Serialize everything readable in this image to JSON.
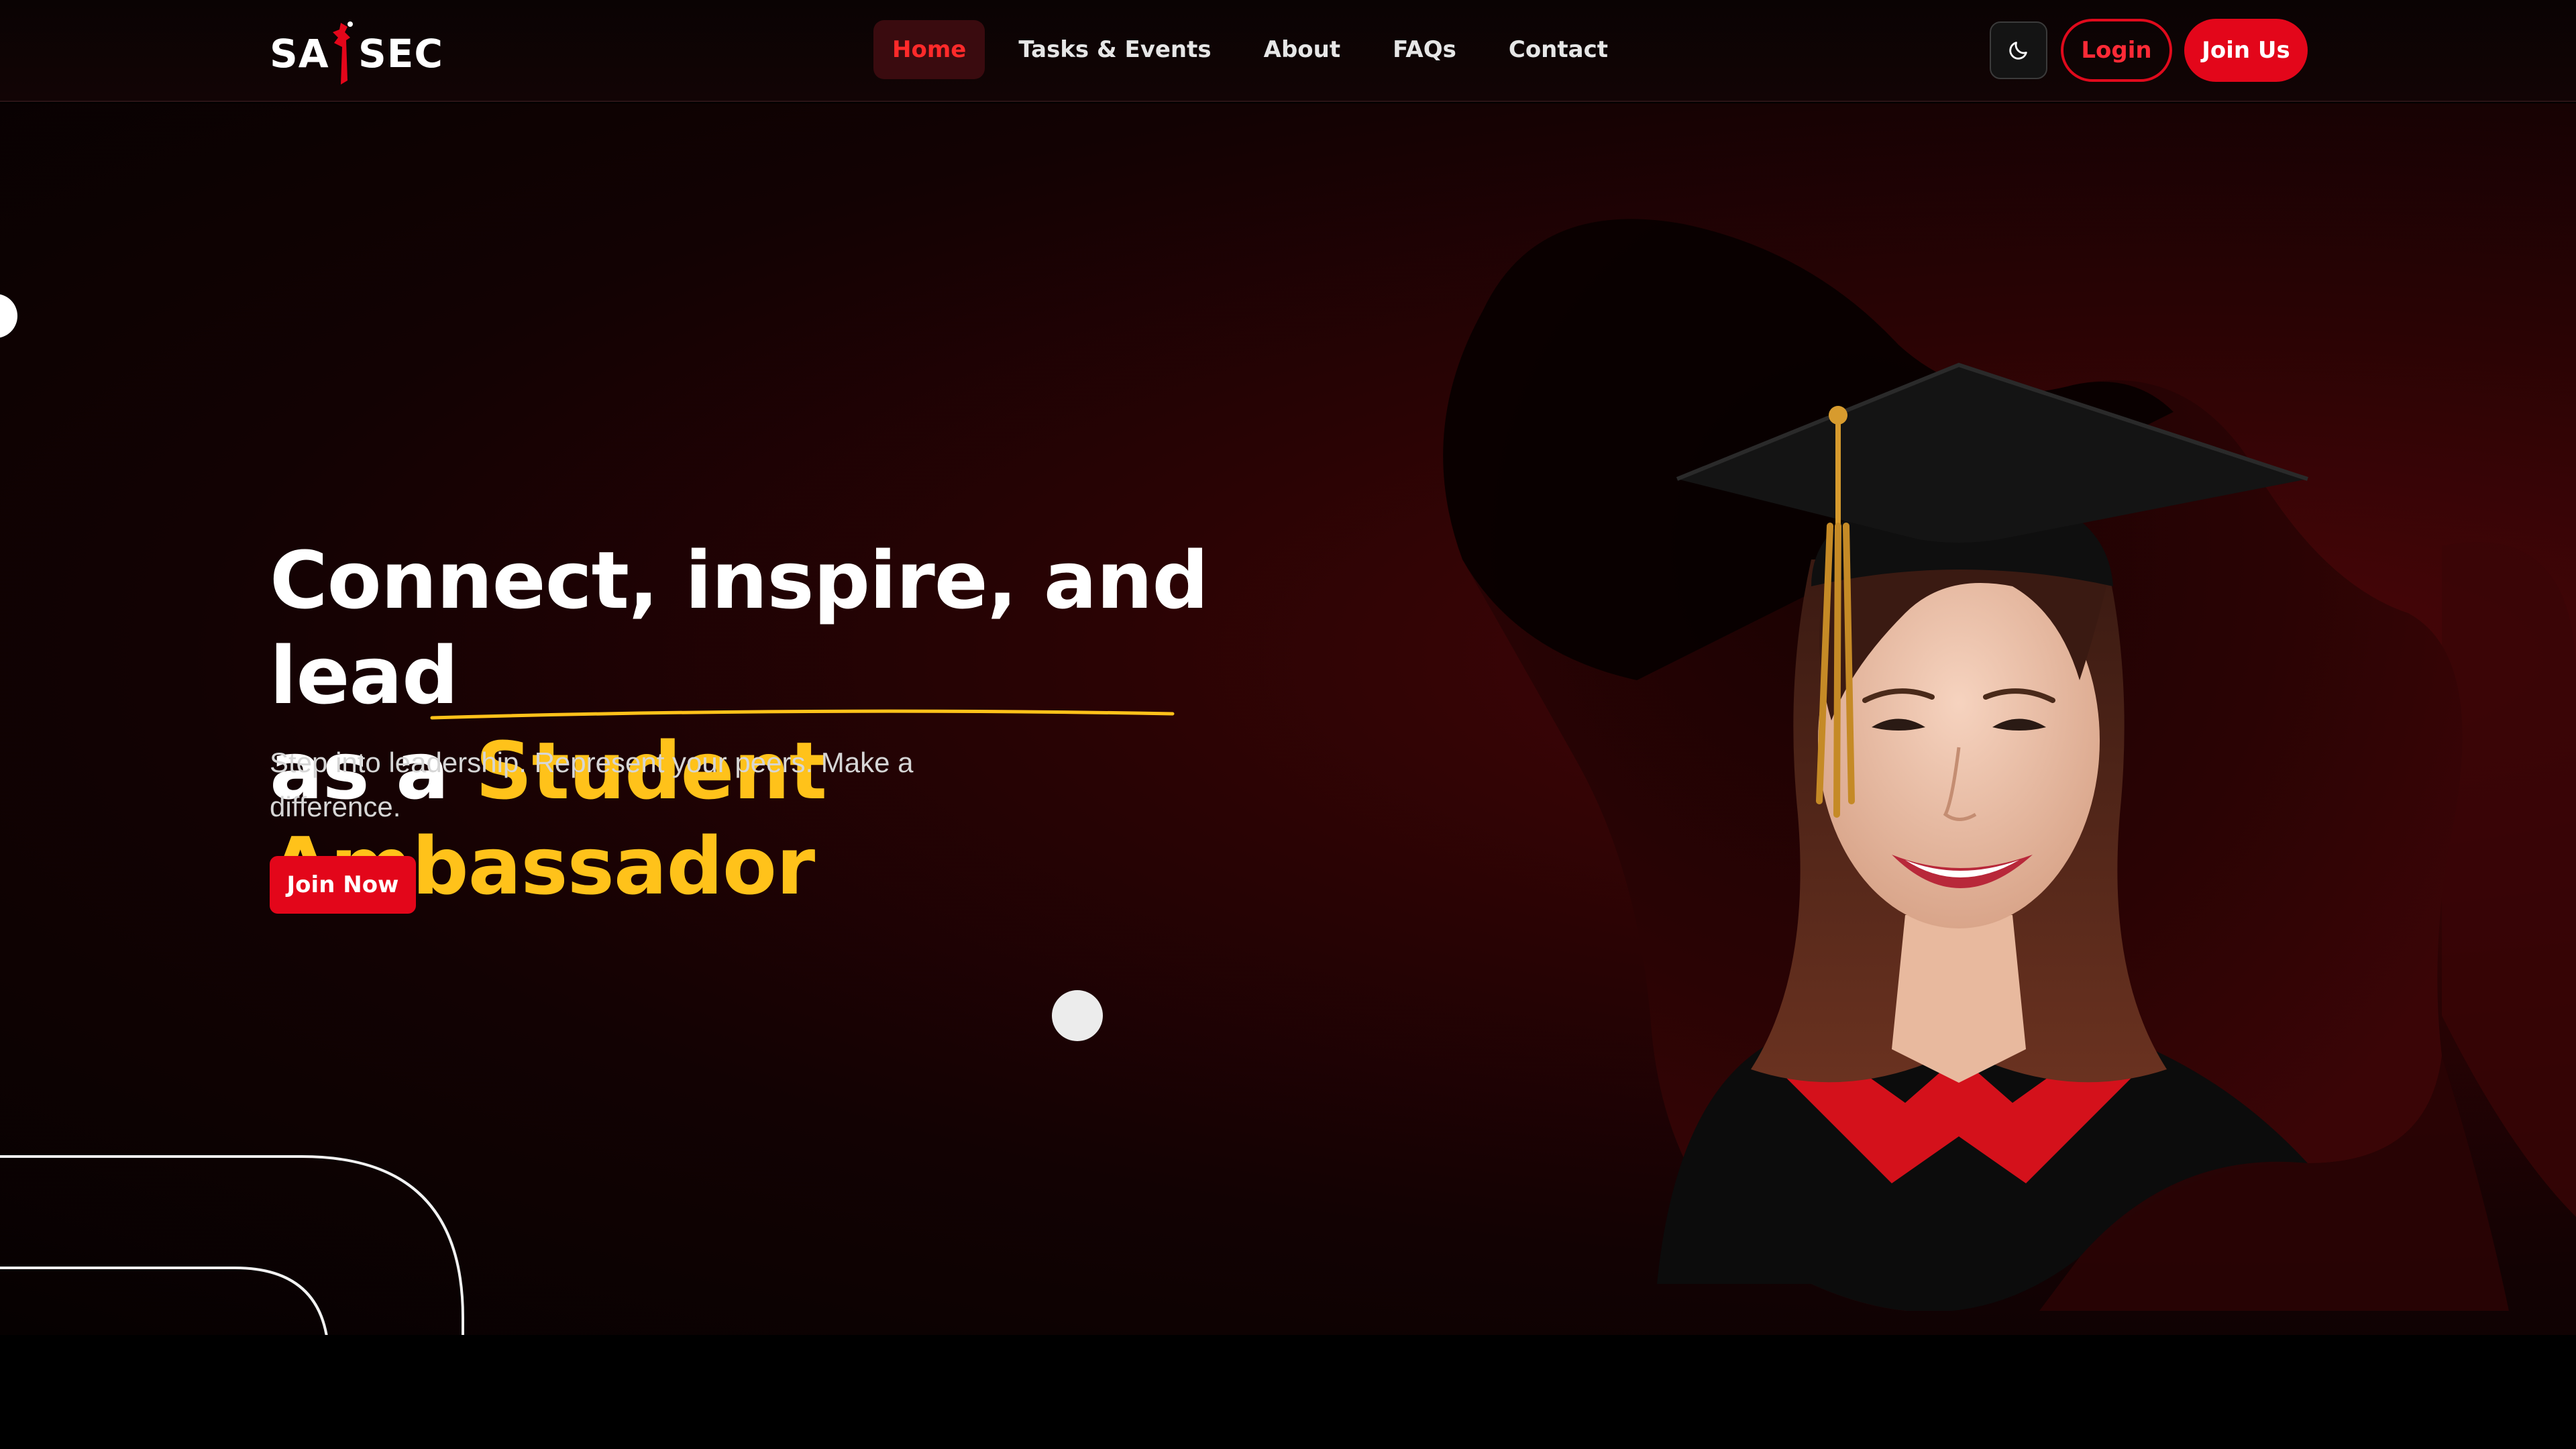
{
  "nav": {
    "logo_left": "SA",
    "logo_right": "SEC",
    "links": [
      "Home",
      "Tasks & Events",
      "About",
      "FAQs",
      "Contact"
    ],
    "active_index": 0,
    "login_label": "Login",
    "join_label": "Join Us",
    "theme_icon": "moon-icon"
  },
  "hero": {
    "title_line1": "Connect, inspire, and lead",
    "title_prefix": "as a",
    "title_highlight": "Student Ambassador",
    "subtitle": "Step into leadership. Represent your peers. Make a difference.",
    "cta_label": "Join Now",
    "image": "graduate-portrait"
  },
  "colors": {
    "accent": "#e3061a",
    "highlight": "#ffc21a",
    "background": "#120203"
  }
}
